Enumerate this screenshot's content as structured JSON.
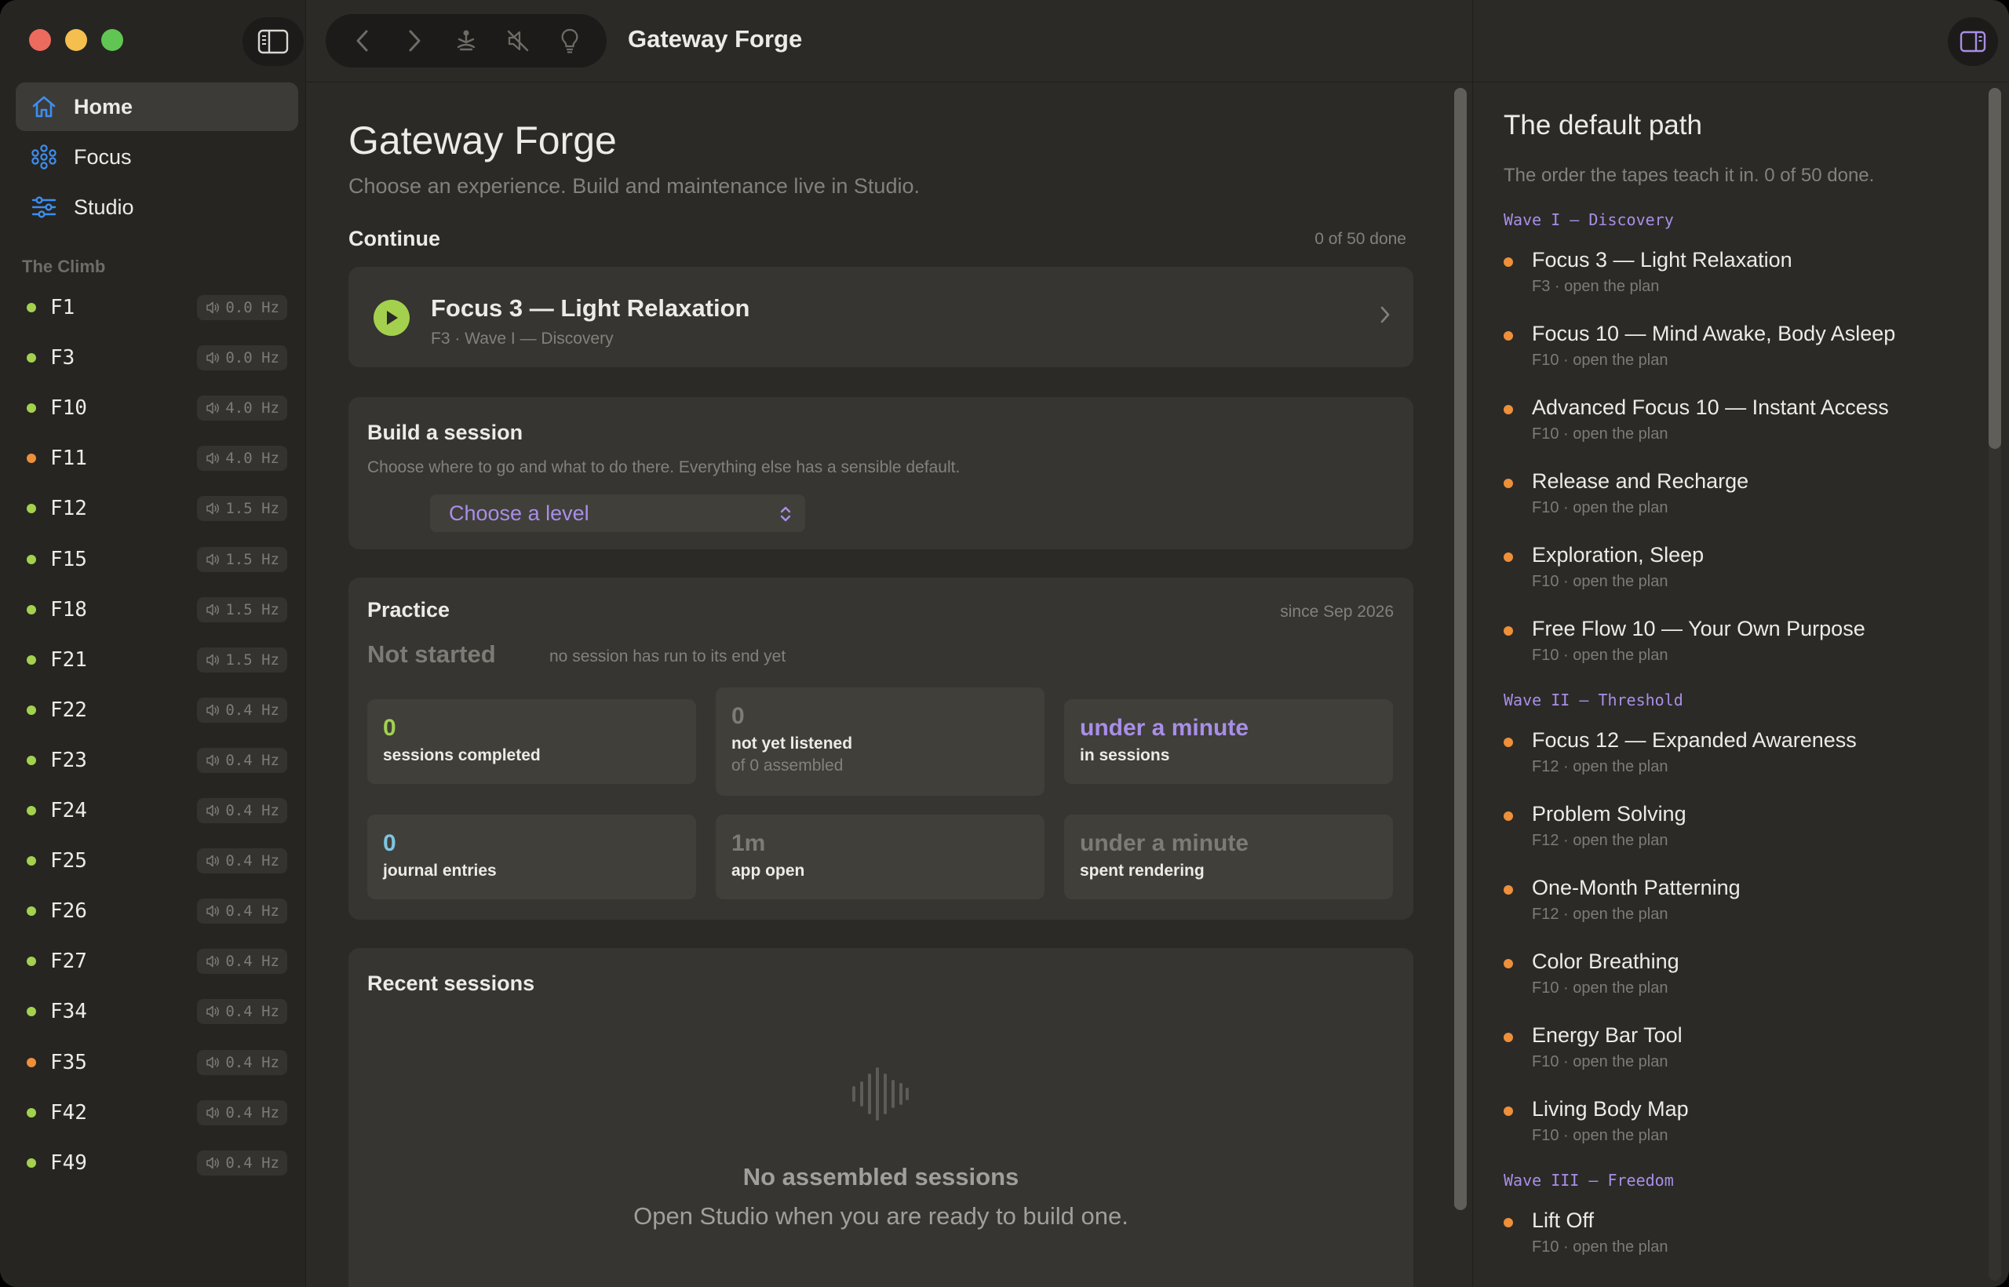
{
  "app": {
    "title": "Gateway Forge"
  },
  "sidebar": {
    "nav": [
      {
        "label": "Home",
        "icon": "home-icon"
      },
      {
        "label": "Focus",
        "icon": "focus-nodes-icon"
      },
      {
        "label": "Studio",
        "icon": "sliders-icon"
      }
    ],
    "section_label": "The Climb",
    "climb": [
      {
        "name": "F1",
        "hz": "0.0 Hz",
        "status": "green"
      },
      {
        "name": "F3",
        "hz": "0.0 Hz",
        "status": "green"
      },
      {
        "name": "F10",
        "hz": "4.0 Hz",
        "status": "green"
      },
      {
        "name": "F11",
        "hz": "4.0 Hz",
        "status": "orange"
      },
      {
        "name": "F12",
        "hz": "1.5 Hz",
        "status": "green"
      },
      {
        "name": "F15",
        "hz": "1.5 Hz",
        "status": "green"
      },
      {
        "name": "F18",
        "hz": "1.5 Hz",
        "status": "green"
      },
      {
        "name": "F21",
        "hz": "1.5 Hz",
        "status": "green"
      },
      {
        "name": "F22",
        "hz": "0.4 Hz",
        "status": "green"
      },
      {
        "name": "F23",
        "hz": "0.4 Hz",
        "status": "green"
      },
      {
        "name": "F24",
        "hz": "0.4 Hz",
        "status": "green"
      },
      {
        "name": "F25",
        "hz": "0.4 Hz",
        "status": "green"
      },
      {
        "name": "F26",
        "hz": "0.4 Hz",
        "status": "green"
      },
      {
        "name": "F27",
        "hz": "0.4 Hz",
        "status": "green"
      },
      {
        "name": "F34",
        "hz": "0.4 Hz",
        "status": "green"
      },
      {
        "name": "F35",
        "hz": "0.4 Hz",
        "status": "orange"
      },
      {
        "name": "F42",
        "hz": "0.4 Hz",
        "status": "green"
      },
      {
        "name": "F49",
        "hz": "0.4 Hz",
        "status": "green"
      }
    ]
  },
  "toolbar": {
    "icons": [
      "sidebar-toggle-icon",
      "back-icon",
      "forward-icon",
      "meditation-icon",
      "mute-icon",
      "lightbulb-icon",
      "inspector-toggle-icon"
    ]
  },
  "main": {
    "title": "Gateway Forge",
    "subtitle": "Choose an experience. Build and maintenance live in Studio.",
    "continue": {
      "label": "Continue",
      "progress": "0 of 50 done",
      "title": "Focus 3 — Light Relaxation",
      "meta": "F3 · Wave I — Discovery"
    },
    "build": {
      "title": "Build a session",
      "description": "Choose where to go and what to do there. Everything else has a sensible default.",
      "level_placeholder": "Choose a level"
    },
    "practice": {
      "title": "Practice",
      "since": "since Sep 2026",
      "status": "Not started",
      "status_note": "no session has run to its end yet",
      "stats": [
        {
          "value": "0",
          "label": "sessions completed",
          "sub": "",
          "color": "#a3d14e"
        },
        {
          "value": "0",
          "label": "not yet listened",
          "sub": "of 0 assembled",
          "color": "#7d7b75"
        },
        {
          "value": "under a minute",
          "label": "in sessions",
          "sub": "",
          "color": "#a98ee8"
        },
        {
          "value": "0",
          "label": "journal entries",
          "sub": "",
          "color": "#7fc4e4"
        },
        {
          "value": "1m",
          "label": "app open",
          "sub": "",
          "color": "#7d7b75"
        },
        {
          "value": "under a minute",
          "label": "spent rendering",
          "sub": "",
          "color": "#7d7b75"
        }
      ]
    },
    "recent": {
      "title": "Recent sessions",
      "empty_title": "No assembled sessions",
      "empty_sub": "Open Studio when you are ready to build one."
    }
  },
  "right": {
    "title": "The default path",
    "subtitle": "The order the tapes teach it in. 0 of 50 done.",
    "waves": [
      {
        "label": "Wave I — Discovery",
        "items": [
          {
            "title": "Focus 3 — Light Relaxation",
            "meta": "F3 · open the plan"
          },
          {
            "title": "Focus 10 — Mind Awake, Body Asleep",
            "meta": "F10 · open the plan"
          },
          {
            "title": "Advanced Focus 10 — Instant Access",
            "meta": "F10 · open the plan"
          },
          {
            "title": "Release and Recharge",
            "meta": "F10 · open the plan"
          },
          {
            "title": "Exploration, Sleep",
            "meta": "F10 · open the plan"
          },
          {
            "title": "Free Flow 10 — Your Own Purpose",
            "meta": "F10 · open the plan"
          }
        ]
      },
      {
        "label": "Wave II — Threshold",
        "items": [
          {
            "title": "Focus 12 — Expanded Awareness",
            "meta": "F12 · open the plan"
          },
          {
            "title": "Problem Solving",
            "meta": "F12 · open the plan"
          },
          {
            "title": "One-Month Patterning",
            "meta": "F12 · open the plan"
          },
          {
            "title": "Color Breathing",
            "meta": "F10 · open the plan"
          },
          {
            "title": "Energy Bar Tool",
            "meta": "F10 · open the plan"
          },
          {
            "title": "Living Body Map",
            "meta": "F10 · open the plan"
          }
        ]
      },
      {
        "label": "Wave III — Freedom",
        "items": [
          {
            "title": "Lift Off",
            "meta": "F10 · open the plan"
          }
        ]
      }
    ]
  }
}
